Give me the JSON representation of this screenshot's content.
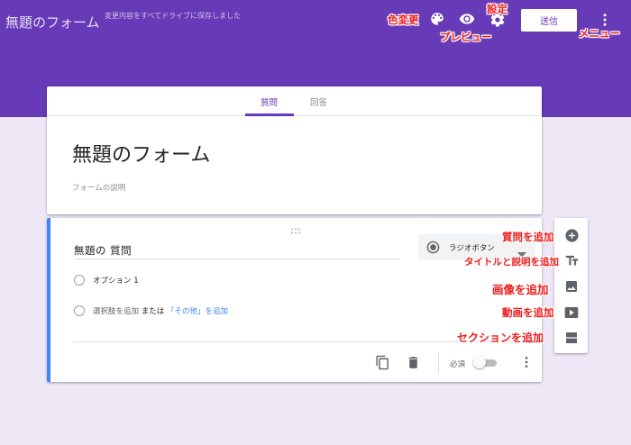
{
  "header": {
    "app_title": "無題のフォーム",
    "save_status": "変更内容をすべてドライブに保存しました",
    "send_label": "送信"
  },
  "annotations": {
    "color_change": "色変更",
    "preview": "プレビュー",
    "settings": "設定",
    "menu": "メニュー",
    "add_question": "質問を追加",
    "add_title_desc": "タイトルと説明を追加",
    "add_image": "画像を追加",
    "add_video": "動画を追加",
    "add_section": "セクションを追加"
  },
  "tabs": [
    {
      "label": "質問",
      "active": true
    },
    {
      "label": "回答",
      "active": false
    }
  ],
  "form": {
    "title": "無題のフォーム",
    "description_placeholder": "フォームの説明"
  },
  "question": {
    "title": "無題の 質問",
    "type": "ラジオボタン",
    "options": [
      "オプション 1"
    ],
    "add_option": "選択肢を追加",
    "or": "または",
    "add_other": "「その他」を追加",
    "required_label": "必須"
  },
  "colors": {
    "brand": "#673ab7",
    "background": "#ede7f6",
    "annotation": "#ee1c1c",
    "accent_blue": "#4285f4"
  },
  "icons": [
    "palette-icon",
    "eye-icon",
    "gear-icon",
    "more-vert-icon",
    "drag-handle-icon",
    "radio-button-icon",
    "chevron-down-icon",
    "copy-icon",
    "trash-icon",
    "add-circle-icon",
    "title-icon",
    "image-icon",
    "video-icon",
    "section-icon"
  ]
}
